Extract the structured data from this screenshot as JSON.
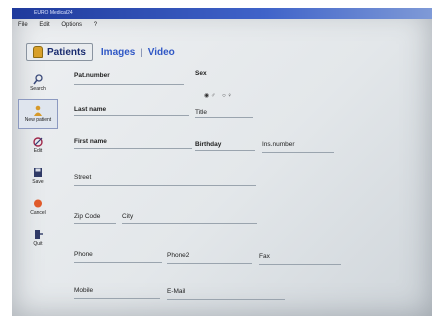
{
  "window": {
    "title": "EURO Medical24"
  },
  "menu": [
    "File",
    "Edit",
    "Options",
    "?"
  ],
  "tabs": {
    "patients": "Patients",
    "images": "Images",
    "video": "Video",
    "separator": "|"
  },
  "sidebar": [
    {
      "label": "Search",
      "icon": "magnifier-icon"
    },
    {
      "label": "New patient",
      "icon": "new-patient-icon"
    },
    {
      "label": "Edit",
      "icon": "edit-icon"
    },
    {
      "label": "Save",
      "icon": "disk-icon"
    },
    {
      "label": "Cancel",
      "icon": "cancel-icon"
    },
    {
      "label": "Quit",
      "icon": "quit-icon"
    }
  ],
  "form": {
    "pat_number": "Pat.number",
    "sex": "Sex",
    "sex_options": {
      "male": "♂",
      "female": "♀"
    },
    "last_name": "Last name",
    "title": "Title",
    "first_name": "First name",
    "birthday": "Birthday",
    "ins_number": "Ins.number",
    "street": "Street",
    "zip_code": "Zip Code",
    "city": "City",
    "phone": "Phone",
    "phone2": "Phone2",
    "fax": "Fax",
    "mobile": "Mobile",
    "email": "E-Mail"
  }
}
